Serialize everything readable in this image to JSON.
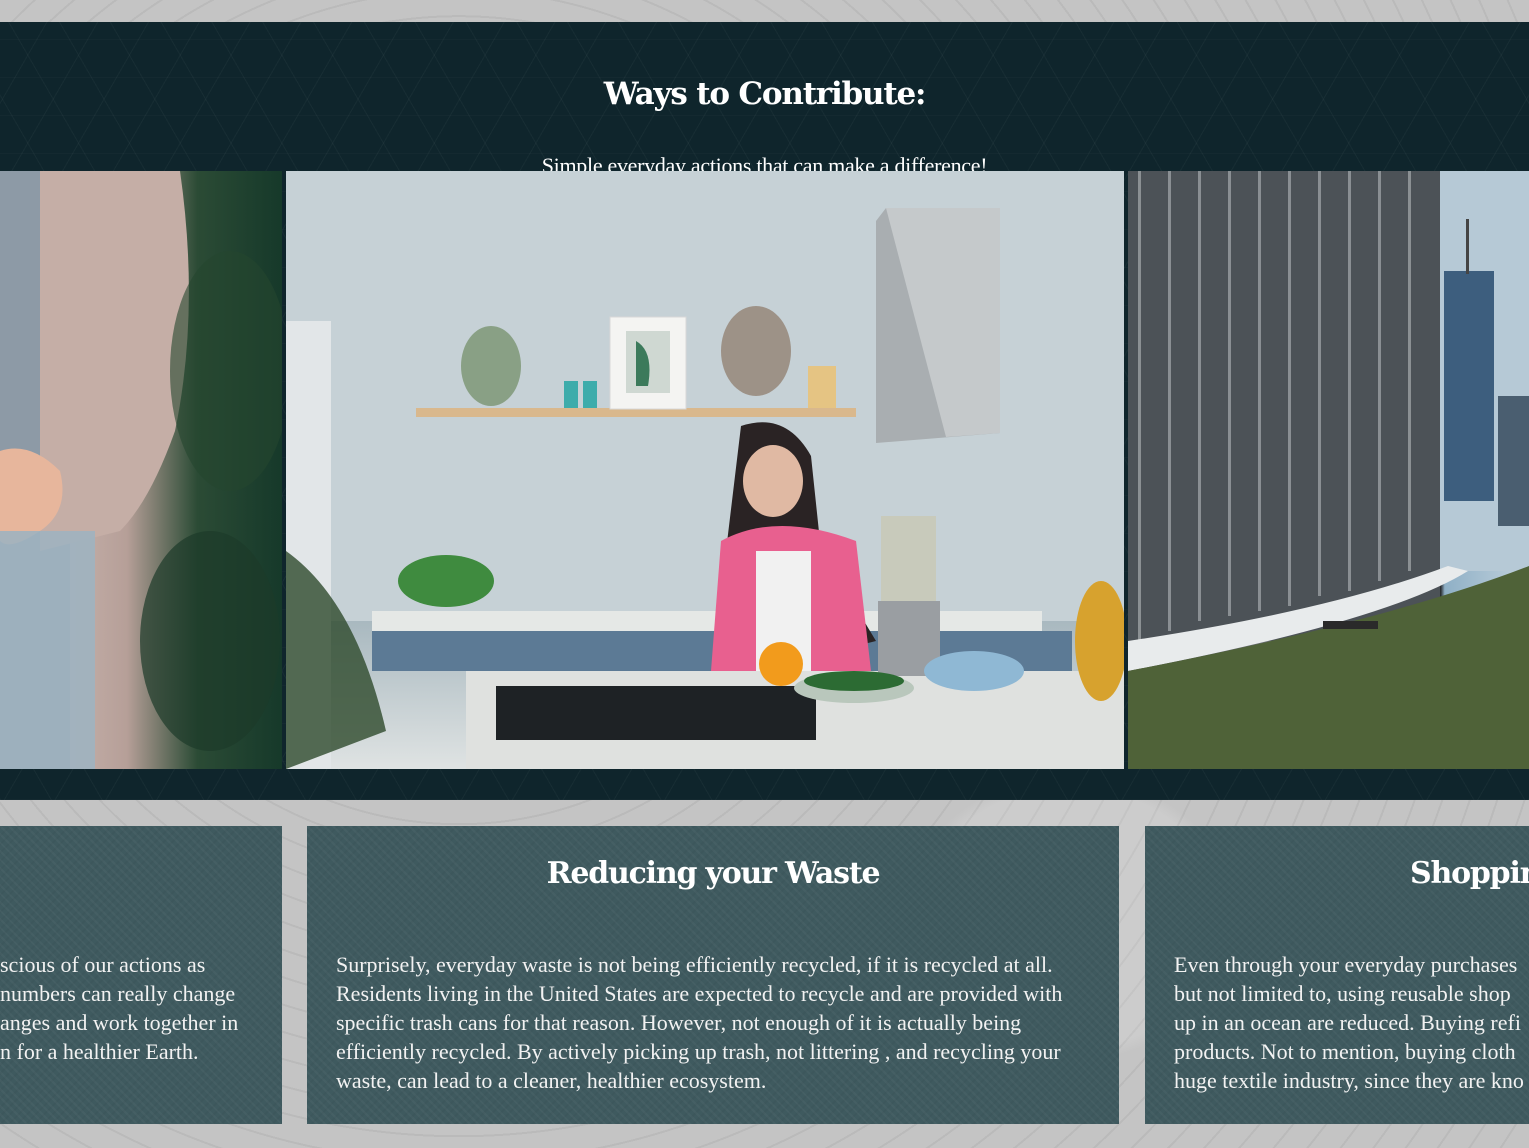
{
  "section": {
    "title": "Ways to Contribute:",
    "subtitle": "Simple everyday actions that can make a difference!"
  },
  "photos": [
    {
      "icon": "person-holding-plant-photo"
    },
    {
      "icon": "woman-in-kitchen-blender-photo"
    },
    {
      "icon": "green-roof-building-photo"
    }
  ],
  "cards": [
    {
      "title": "",
      "lines": [
        "scious of our actions as",
        " numbers can really change",
        "anges and work together in",
        "n for a healthier Earth."
      ]
    },
    {
      "title": "Reducing your Waste",
      "body": "Surprisely, everyday waste is not being efficiently recycled, if it is recycled at all. Residents living in the United States are expected to recycle and are provided with specific trash cans for that reason. However, not enough of it is actually being efficiently recycled. By actively picking up trash, not littering , and recycling your waste, can lead to a cleaner, healthier ecosystem."
    },
    {
      "title": "Shopping",
      "lines": [
        "Even through your everyday purchases",
        "but not limited to, using reusable shop",
        "up in an ocean are reduced. Buying refi",
        "products. Not to mention, buying cloth",
        "huge textile industry, since they are kno"
      ]
    }
  ],
  "colors": {
    "band": "#0f252c",
    "card": "#3f5a5f",
    "background": "#c4c4c4"
  }
}
